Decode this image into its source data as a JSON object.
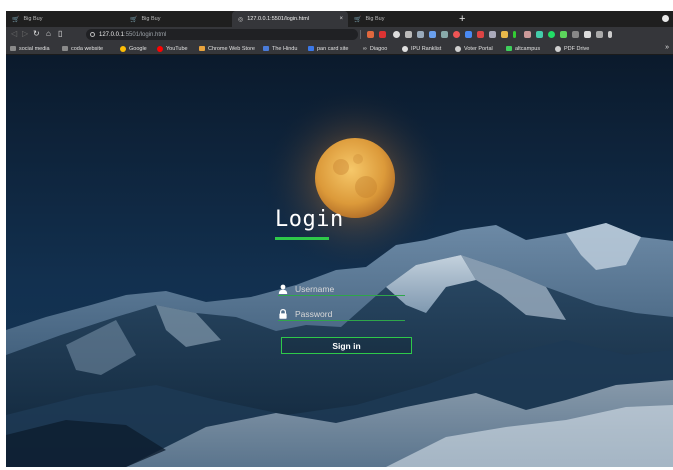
{
  "tabs": [
    {
      "title": "Big Buy",
      "icon": "cart-icon",
      "active": false
    },
    {
      "title": "Big Buy",
      "icon": "cart-icon",
      "active": false
    },
    {
      "title": "127.0.0.1:5501/login.html",
      "icon": "globe-icon",
      "active": true
    },
    {
      "title": "Big Buy",
      "icon": "cart-icon",
      "active": false
    }
  ],
  "new_tab_label": "+",
  "close_tab_label": "×",
  "address_bar": {
    "host": "127.0.0.1",
    "path": ":5501/login.html"
  },
  "bookmarks": [
    {
      "label": "social media",
      "icon": "folder-icon",
      "color": "#8a8a8a"
    },
    {
      "label": "coda website",
      "icon": "folder-icon",
      "color": "#8a8a8a"
    },
    {
      "label": "Google",
      "icon": "google-icon",
      "color": "#fbbc05"
    },
    {
      "label": "YouTube",
      "icon": "youtube-icon",
      "color": "#ff0000"
    },
    {
      "label": "Chrome Web Store",
      "icon": "webstore-icon",
      "color": "#e8a33d"
    },
    {
      "label": "The Hindu",
      "icon": "news-icon",
      "color": "#4a7bd8"
    },
    {
      "label": "pan card site",
      "icon": "site-icon",
      "color": "#3b78e7"
    },
    {
      "label": "Diagoo",
      "icon": "infinity-icon",
      "color": "#d0d0d0"
    },
    {
      "label": "IPU Ranklist",
      "icon": "rank-icon",
      "color": "#e0e0e0"
    },
    {
      "label": "Voter Portal",
      "icon": "globe-icon",
      "color": "#d0d0d0"
    },
    {
      "label": "altcampus",
      "icon": "altcampus-icon",
      "color": "#3ecf5c"
    },
    {
      "label": "PDF Drive",
      "icon": "drive-icon",
      "color": "#d0d0d0"
    }
  ],
  "bookmarks_more": "»",
  "login": {
    "title": "Login",
    "username_placeholder": "Username",
    "password_placeholder": "Password",
    "signin_label": "Sign in"
  },
  "colors": {
    "accent": "#2ec94a",
    "sky_top": "#0b1a2c",
    "sky_bottom": "#163859",
    "moon": "#e8a640"
  }
}
